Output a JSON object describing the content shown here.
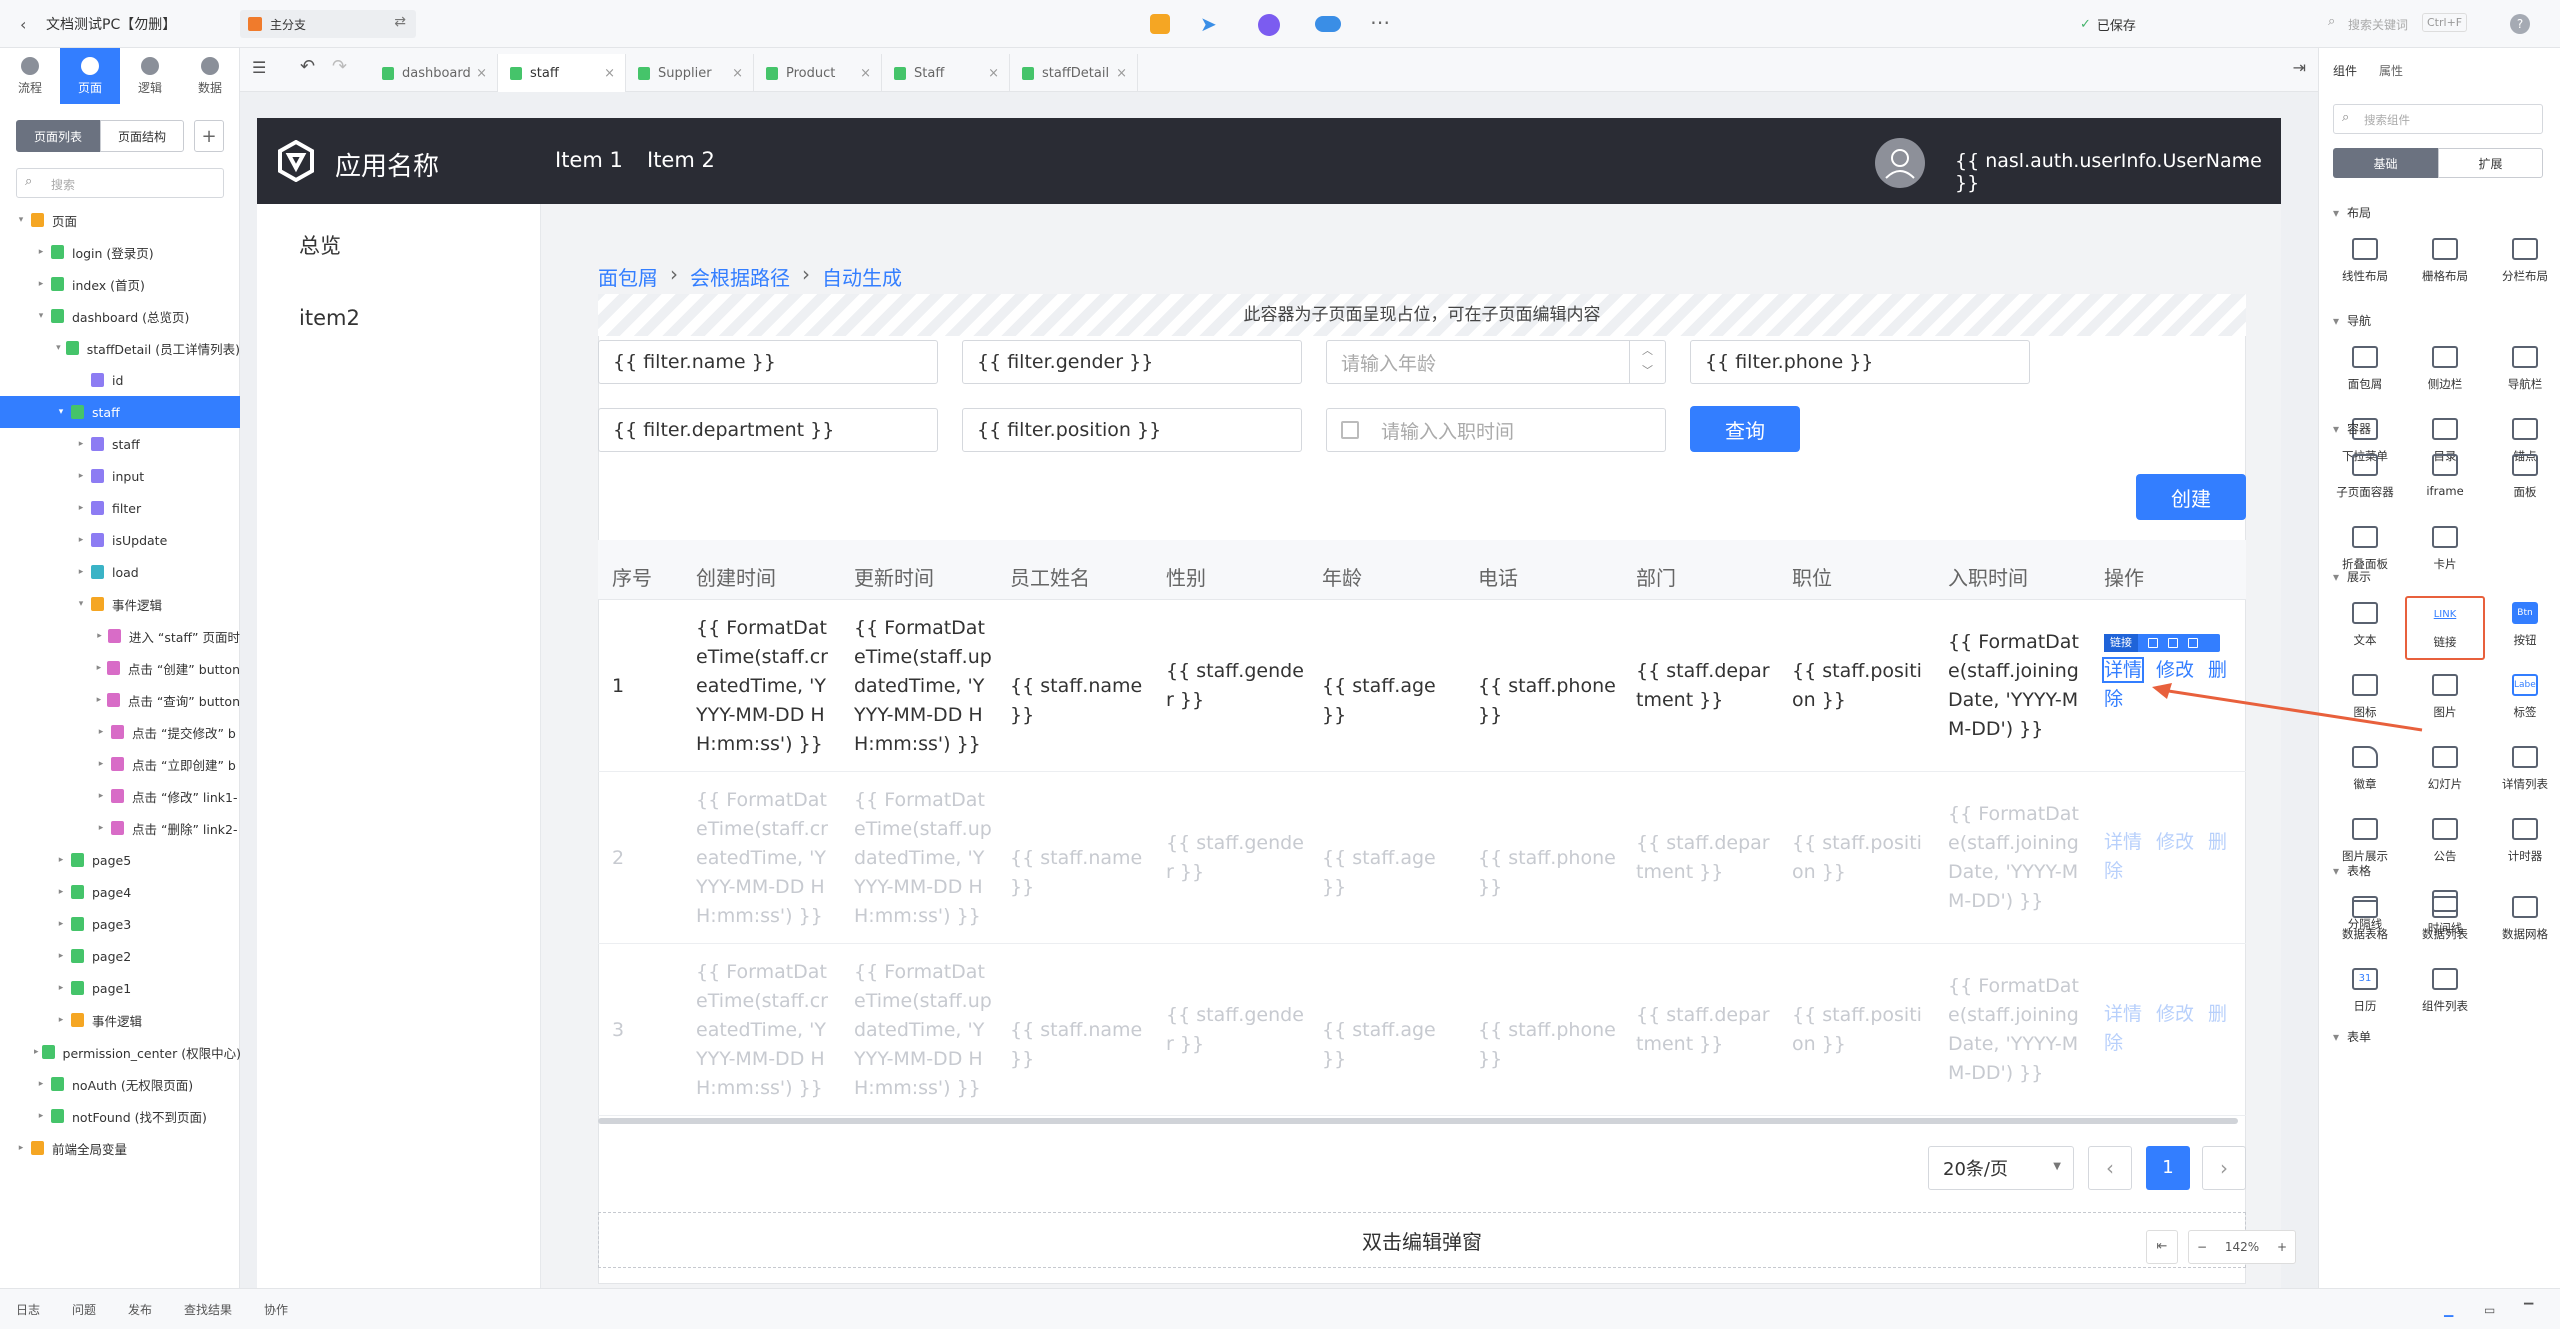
{
  "topbar": {
    "back_icon": "chevron-left-icon",
    "app_name": "文档测试PC【勿删】",
    "branch": "主分支",
    "save_status": "已保存",
    "search_placeholder": "搜索关键词",
    "search_shortcut": "Ctrl+F",
    "help": "?"
  },
  "mode_tabs": [
    {
      "label": "流程",
      "icon": "flow-icon"
    },
    {
      "label": "页面",
      "icon": "page-icon"
    },
    {
      "label": "逻辑",
      "icon": "logic-icon"
    },
    {
      "label": "数据",
      "icon": "data-icon"
    }
  ],
  "left_panel": {
    "view_tabs": [
      "页面列表",
      "页面结构"
    ],
    "add": "+",
    "search_placeholder": "搜索",
    "tree": [
      {
        "label": "页面",
        "level": 0,
        "type": "folder",
        "open": true
      },
      {
        "label": "login (登录页)",
        "level": 1,
        "type": "page"
      },
      {
        "label": "index (首页)",
        "level": 1,
        "type": "page"
      },
      {
        "label": "dashboard (总览页)",
        "level": 1,
        "type": "page",
        "open": true
      },
      {
        "label": "staffDetail (员工详情列表)",
        "level": 2,
        "type": "page",
        "open": true
      },
      {
        "label": "id",
        "level": 3,
        "type": "var"
      },
      {
        "label": "staff",
        "level": 2,
        "type": "page",
        "open": true,
        "selected": true
      },
      {
        "label": "staff",
        "level": 3,
        "type": "var"
      },
      {
        "label": "input",
        "level": 3,
        "type": "var"
      },
      {
        "label": "filter",
        "level": 3,
        "type": "var"
      },
      {
        "label": "isUpdate",
        "level": 3,
        "type": "var"
      },
      {
        "label": "load",
        "level": 3,
        "type": "load"
      },
      {
        "label": "事件逻辑",
        "level": 3,
        "type": "folder",
        "open": true
      },
      {
        "label": "进入 “staff” 页面时",
        "level": 4,
        "type": "logic"
      },
      {
        "label": "点击 “创建” button",
        "level": 4,
        "type": "logic"
      },
      {
        "label": "点击 “查询” button",
        "level": 4,
        "type": "logic"
      },
      {
        "label": "点击 “提交修改” b",
        "level": 4,
        "type": "logic"
      },
      {
        "label": "点击 “立即创建” b",
        "level": 4,
        "type": "logic"
      },
      {
        "label": "点击 “修改” link1-",
        "level": 4,
        "type": "logic"
      },
      {
        "label": "点击 “删除” link2-",
        "level": 4,
        "type": "logic"
      },
      {
        "label": "page5",
        "level": 2,
        "type": "page"
      },
      {
        "label": "page4",
        "level": 2,
        "type": "page"
      },
      {
        "label": "page3",
        "level": 2,
        "type": "page"
      },
      {
        "label": "page2",
        "level": 2,
        "type": "page"
      },
      {
        "label": "page1",
        "level": 2,
        "type": "page"
      },
      {
        "label": "事件逻辑",
        "level": 2,
        "type": "folder"
      },
      {
        "label": "permission_center (权限中心)",
        "level": 1,
        "type": "page"
      },
      {
        "label": "noAuth (无权限页面)",
        "level": 1,
        "type": "page"
      },
      {
        "label": "notFound (找不到页面)",
        "level": 1,
        "type": "page"
      },
      {
        "label": "前端全局变量",
        "level": 0,
        "type": "folder"
      }
    ]
  },
  "editor_tabs": [
    {
      "label": "dashboard",
      "active": false
    },
    {
      "label": "staff",
      "active": true
    },
    {
      "label": "Supplier",
      "active": false
    },
    {
      "label": "Product",
      "active": false
    },
    {
      "label": "Staff",
      "active": false
    },
    {
      "label": "staffDetail",
      "active": false
    }
  ],
  "app": {
    "name": "应用名称",
    "nav": [
      "Item 1",
      "Item 2"
    ],
    "user": "{{ nasl.auth.userInfo.UserName }}",
    "side_menu": [
      "总览",
      "item2"
    ],
    "breadcrumb": [
      "面包屑",
      "会根据路径",
      "自动生成"
    ],
    "placeholder_notice": "此容器为子页面呈现占位，可在子页面编辑内容",
    "filters": {
      "name": "{{ filter.name }}",
      "gender": "{{ filter.gender }}",
      "age_placeholder": "请输入年龄",
      "phone": "{{ filter.phone }}",
      "department": "{{ filter.department }}",
      "position": "{{ filter.position }}",
      "date_placeholder": "请输入入职时间",
      "query": "查询"
    },
    "create": "创建",
    "table": {
      "headers": [
        "序号",
        "创建时间",
        "更新时间",
        "员工姓名",
        "性别",
        "年龄",
        "电话",
        "部门",
        "职位",
        "入职时间",
        "操作"
      ],
      "rows": [
        [
          "1",
          "{{ FormatDateTime(staff.createdTime, 'YYYY-MM-DD HH:mm:ss') }}",
          "{{ FormatDateTime(staff.updatedTime, 'YYYY-MM-DD HH:mm:ss') }}",
          "{{ staff.name }}",
          "{{ staff.gender }}",
          "{{ staff.age }}",
          "{{ staff.phone }}",
          "{{ staff.department }}",
          "{{ staff.position }}",
          "{{ FormatDate(staff.joiningDate, 'YYYY-MM-DD') }}"
        ],
        [
          "2",
          "{{ FormatDateTime(staff.createdTime, 'YYYY-MM-DD HH:mm:ss') }}",
          "{{ FormatDateTime(staff.updatedTime, 'YYYY-MM-DD HH:mm:ss') }}",
          "{{ staff.name }}",
          "{{ staff.gender }}",
          "{{ staff.age }}",
          "{{ staff.phone }}",
          "{{ staff.department }}",
          "{{ staff.position }}",
          "{{ FormatDate(staff.joiningDate, 'YYYY-MM-DD') }}"
        ],
        [
          "3",
          "{{ FormatDateTime(staff.createdTime, 'YYYY-MM-DD HH:mm:ss') }}",
          "{{ FormatDateTime(staff.updatedTime, 'YYYY-MM-DD HH:mm:ss') }}",
          "{{ staff.name }}",
          "{{ staff.gender }}",
          "{{ staff.age }}",
          "{{ staff.phone }}",
          "{{ staff.department }}",
          "{{ staff.position }}",
          "{{ FormatDate(staff.joiningDate, 'YYYY-MM-DD') }}"
        ]
      ],
      "actions": {
        "detail": "详情",
        "edit": "修改",
        "delete": "删除"
      },
      "selected_tag": "链接"
    },
    "pagination": {
      "page_size": "20条/页",
      "current": "1"
    },
    "modal_hint": "双击编辑弹窗"
  },
  "zoom": "142%",
  "right_panel": {
    "tabs": [
      "组件",
      "属性"
    ],
    "search_placeholder": "搜索组件",
    "sub_tabs": [
      "基础",
      "扩展"
    ],
    "sections": [
      {
        "title": "布局",
        "items": [
          "线性布局",
          "栅格布局",
          "分栏布局"
        ]
      },
      {
        "title": "导航",
        "items": [
          "面包屑",
          "侧边栏",
          "导航栏",
          "下拉菜单",
          "目录",
          "锚点"
        ]
      },
      {
        "title": "容器",
        "items": [
          "子页面容器",
          "iframe",
          "面板",
          "折叠面板",
          "卡片"
        ]
      },
      {
        "title": "展示",
        "items": [
          "文本",
          "链接",
          "按钮",
          "图标",
          "图片",
          "标签",
          "徽章",
          "幻灯片",
          "详情列表",
          "图片展示",
          "公告",
          "计时器",
          "分隔线",
          "时间线"
        ]
      },
      {
        "title": "表格",
        "items": [
          "数据表格",
          "数据列表",
          "数据网格",
          "日历",
          "组件列表"
        ]
      },
      {
        "title": "表单",
        "items": []
      }
    ],
    "highlight_glyph": "LINK",
    "button_glyph": "Btn",
    "label_glyph": "Label",
    "calendar_glyph": "31"
  },
  "bottom_bar": [
    "日志",
    "问题",
    "发布",
    "查找结果",
    "协作"
  ],
  "colors": {
    "accent": "#337eff",
    "header": "#2a2c34",
    "arrow": "#e8603c"
  }
}
